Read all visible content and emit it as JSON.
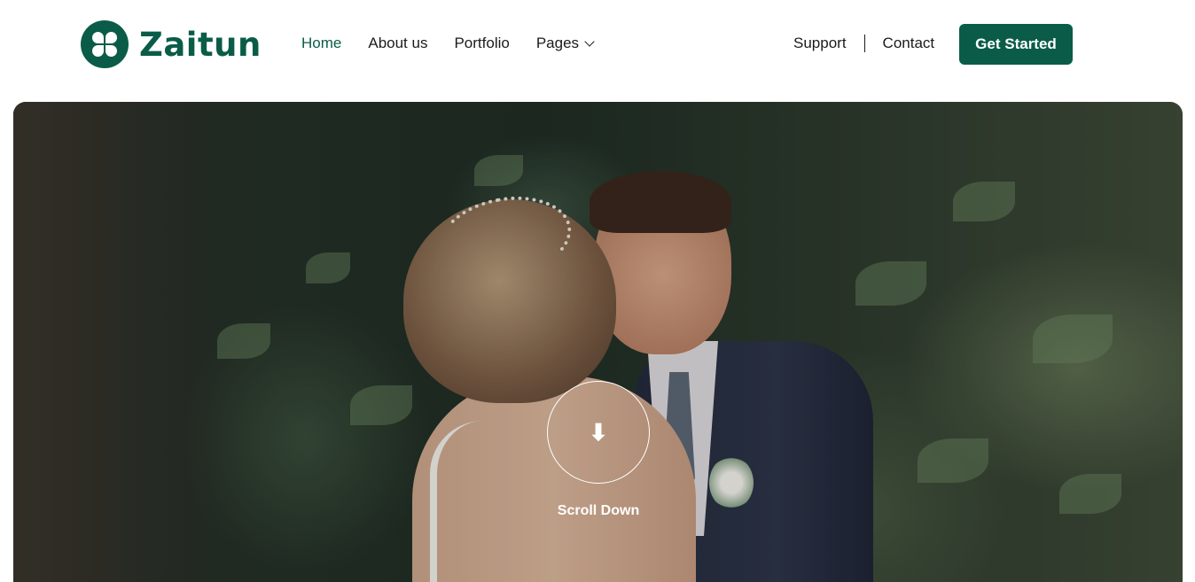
{
  "brand": {
    "name": "Zaitun",
    "logo_icon": "clover-icon",
    "color": "#0a5c48"
  },
  "nav": {
    "items": [
      {
        "label": "Home",
        "active": true
      },
      {
        "label": "About us",
        "active": false
      },
      {
        "label": "Portfolio",
        "active": false
      },
      {
        "label": "Pages",
        "active": false,
        "icon": "chevron-down-icon"
      }
    ]
  },
  "right_nav": {
    "support": "Support",
    "contact": "Contact"
  },
  "cta": {
    "label": "Get Started"
  },
  "hero": {
    "image": "wedding-couple-photo",
    "scroll": {
      "label": "Scroll Down",
      "icon": "arrow-down-icon"
    }
  }
}
